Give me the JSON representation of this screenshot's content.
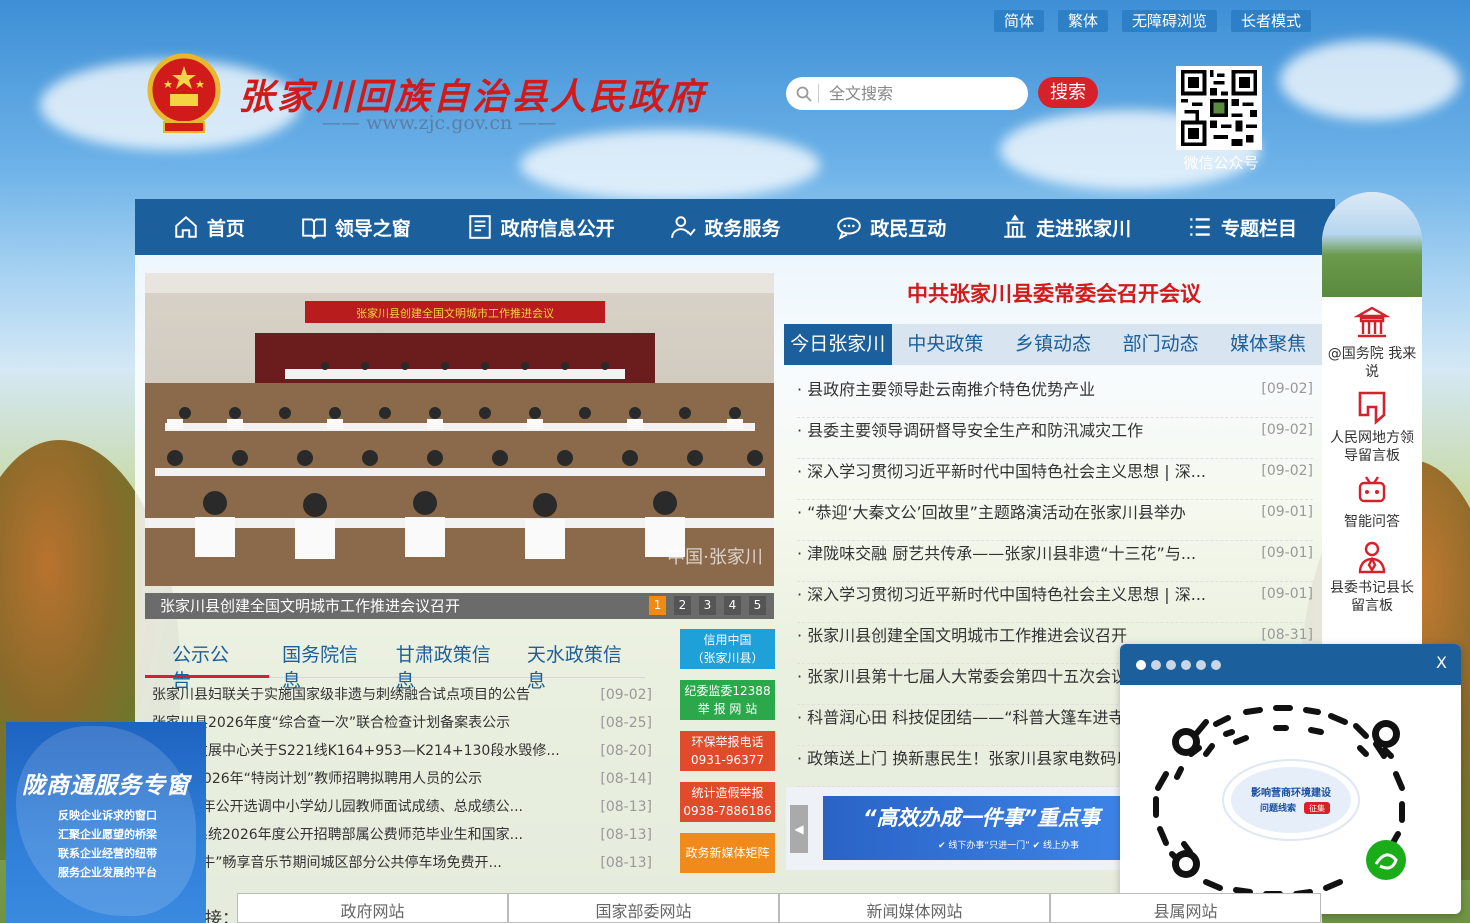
{
  "util_links": [
    "简体",
    "繁体",
    "无障碍浏览",
    "长者模式"
  ],
  "header": {
    "title": "张家川回族自治县人民政府",
    "url": "—— www.zjc.gov.cn ——",
    "search_placeholder": "全文搜索",
    "search_button": "搜索",
    "qr_label": "微信公众号"
  },
  "nav": [
    {
      "label": "首页",
      "icon": "home-icon"
    },
    {
      "label": "领导之窗",
      "icon": "book-icon"
    },
    {
      "label": "政府信息公开",
      "icon": "document-icon"
    },
    {
      "label": "政务服务",
      "icon": "user-service-icon"
    },
    {
      "label": "政民互动",
      "icon": "chat-icon"
    },
    {
      "label": "走进张家川",
      "icon": "building-icon"
    },
    {
      "label": "专题栏目",
      "icon": "list-icon"
    }
  ],
  "slideshow": {
    "banner_text": "张家川县创建全国文明城市工作推进会议",
    "watermark": "中国·张家川",
    "caption": "张家川县创建全国文明城市工作推进会议召开",
    "pages": [
      "1",
      "2",
      "3",
      "4",
      "5"
    ],
    "active_page": "1"
  },
  "left_tabs": [
    "公示公告",
    "国务院信息",
    "甘肃政策信息",
    "天水政策信息"
  ],
  "left_list": [
    {
      "title": "张家川县妇联关于实施国家级非遗与刺绣融合试点项目的公告",
      "date": "[09-02]"
    },
    {
      "title": "张家川县2026年度“综合查一次”联合检查计划备案表公示",
      "date": "[08-25]"
    },
    {
      "title": "路事业发展中心关于S221线K164+953—K214+130段水毁修...",
      "date": "[08-20]"
    },
    {
      "title": "家川县2026年“特岗计划”教师招聘拟聘用人员的公示",
      "date": "[08-14]"
    },
    {
      "title": "县2026年公开选调中小学幼儿园教师面试成绩、总成绩公...",
      "date": "[08-13]"
    },
    {
      "title": "县教育系统2026年度公开招聘部属公费师范毕业生和国家...",
      "date": "[08-13]"
    },
    {
      "title": "届“红花牛”畅享音乐节期间城区部分公共停车场免费开...",
      "date": "[08-13]"
    }
  ],
  "side_buttons": [
    {
      "line1": "信用中国",
      "line2": "（张家川县）",
      "color": "#1ea0d8"
    },
    {
      "line1": "纪委监委12388",
      "line2": "举 报 网 站",
      "color": "#2aa84a"
    },
    {
      "line1": "环保举报电话",
      "line2": "0931-96377",
      "color": "#e04b2b"
    },
    {
      "line1": "统计造假举报",
      "line2": "0938-7886186",
      "color": "#e04b2b"
    },
    {
      "line1": "政务新媒体矩阵",
      "line2": "",
      "color": "#f08a1a"
    }
  ],
  "headline": "中共张家川县委常委会召开会议",
  "right_tabs": [
    "今日张家川",
    "中央政策",
    "乡镇动态",
    "部门动态",
    "媒体聚焦"
  ],
  "right_list": [
    {
      "title": "· 县政府主要领导赴云南推介特色优势产业",
      "date": "[09-02]"
    },
    {
      "title": "· 县委主要领导调研督导安全生产和防汛减灾工作",
      "date": "[09-02]"
    },
    {
      "title": "· 深入学习贯彻习近平新时代中国特色社会主义思想 | 深...",
      "date": "[09-02]"
    },
    {
      "title": "· “恭迎‘大秦文公’回故里”主题路演活动在张家川县举办",
      "date": "[09-01]"
    },
    {
      "title": "· 津陇味交融 厨艺共传承——张家川县非遗“十三花”与...",
      "date": "[09-01]"
    },
    {
      "title": "· 深入学习贯彻习近平新时代中国特色社会主义思想 | 深...",
      "date": "[09-01]"
    },
    {
      "title": "· 张家川县创建全国文明城市工作推进会议召开",
      "date": "[08-31]"
    },
    {
      "title": "· 张家川县第十七届人大常委会第四十五次会议",
      "date": ""
    },
    {
      "title": "· 科普润心田 科技促团结——“科普大篷车进寺",
      "date": ""
    },
    {
      "title": "· 政策送上门 换新惠民生！张家川县家电数码以",
      "date": ""
    }
  ],
  "banner": {
    "text": "“高效办成一件事”重点事",
    "sub": "✔ 线下办事“只进一门”   ✔ 线上办事"
  },
  "side_panel": [
    {
      "label": "@国务院 我来说",
      "icon": "state-council-icon"
    },
    {
      "label": "人民网地方领导留言板",
      "icon": "message-board-icon"
    },
    {
      "label": "智能问答",
      "icon": "robot-icon"
    },
    {
      "label": "县委书记县长留言板",
      "icon": "leader-icon"
    }
  ],
  "left_ad": {
    "title": "陇商通服务专窗",
    "lines": [
      "反映企业诉求的窗口",
      "汇聚企业愿望的桥梁",
      "联系企业经营的纽带",
      "服务企业发展的平台"
    ]
  },
  "popup": {
    "dots": 6,
    "close": "X",
    "qr_center_line1": "影响营商环境建设",
    "qr_center_line2": "问题线索",
    "qr_badge": "征集"
  },
  "links_label": "接：",
  "links": [
    "政府网站",
    "国家部委网站",
    "新闻媒体网站",
    "县属网站"
  ]
}
